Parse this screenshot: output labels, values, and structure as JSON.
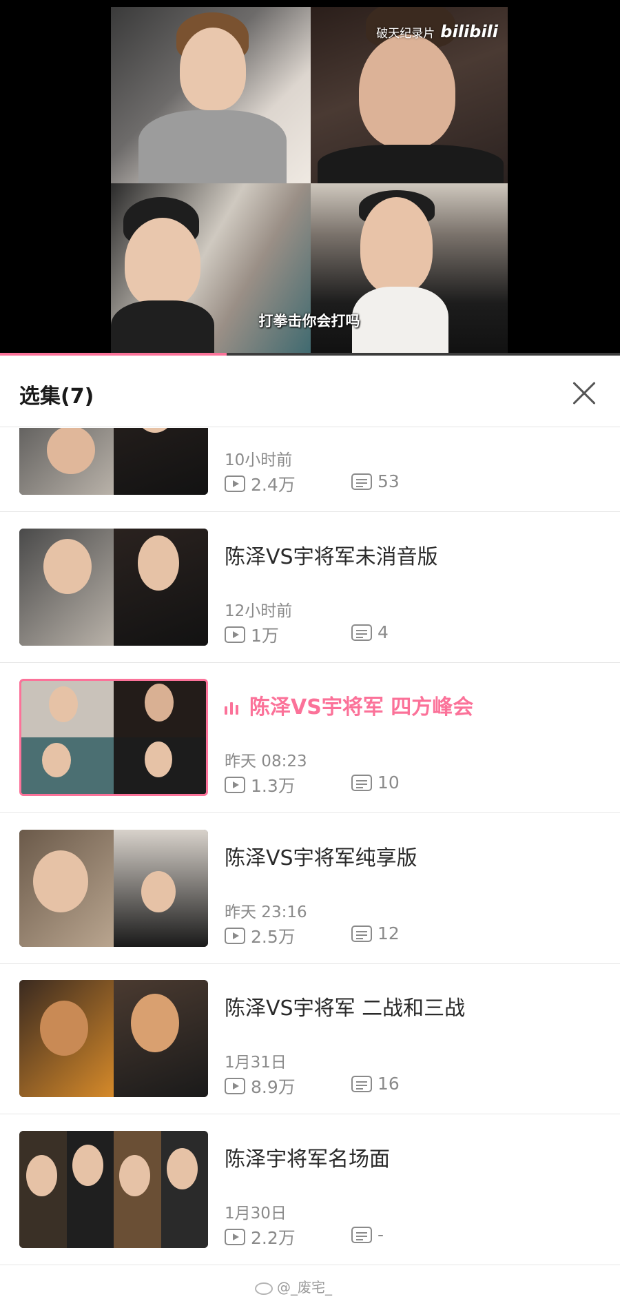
{
  "player": {
    "channel_watermark": "破天纪录片",
    "brand_watermark": "bilibili",
    "subtitle": "打拳击你会打吗",
    "progress": 0.365
  },
  "sheet": {
    "title": "选集(7)"
  },
  "episodes": [
    {
      "title": "",
      "time": "10小时前",
      "views": "2.4万",
      "danmaku": "53",
      "active": false
    },
    {
      "title": "陈泽VS宇将军未消音版",
      "time": "12小时前",
      "views": "1万",
      "danmaku": "4",
      "active": false
    },
    {
      "title": "陈泽VS宇将军 四方峰会",
      "time": "昨天 08:23",
      "views": "1.3万",
      "danmaku": "10",
      "active": true
    },
    {
      "title": "陈泽VS宇将军纯享版",
      "time": "昨天 23:16",
      "views": "2.5万",
      "danmaku": "12",
      "active": false
    },
    {
      "title": "陈泽VS宇将军 二战和三战",
      "time": "1月31日",
      "views": "8.9万",
      "danmaku": "16",
      "active": false
    },
    {
      "title": "陈泽宇将军名场面",
      "time": "1月30日",
      "views": "2.2万",
      "danmaku": "-",
      "active": false
    }
  ],
  "footer": {
    "watermark": "@_废宅_"
  },
  "colors": {
    "accent": "#fb7299",
    "secondary_text": "#8a8a8a",
    "player_bg": "#000000"
  }
}
